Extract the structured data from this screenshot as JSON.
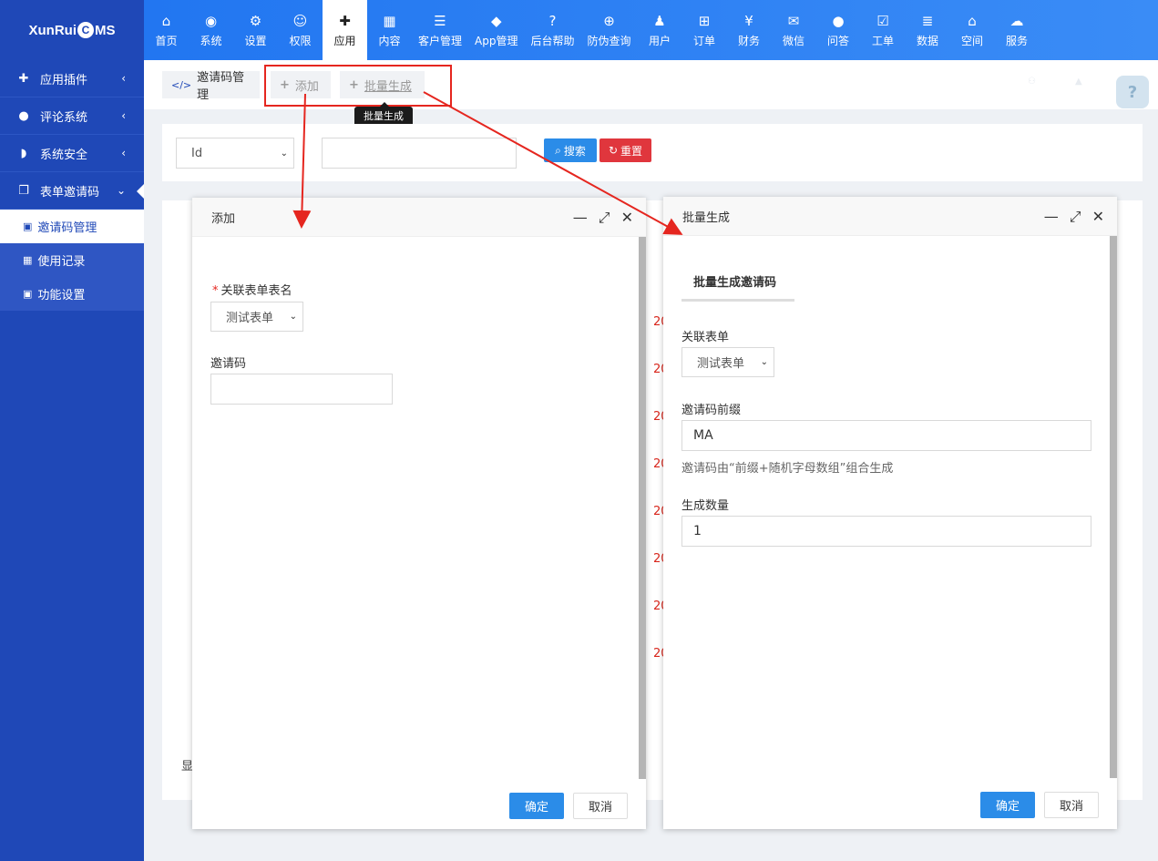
{
  "brand": {
    "logo_prefix": "XunRui",
    "logo_c": "C",
    "logo_suffix": "MS"
  },
  "nav": [
    {
      "label": "首页",
      "icon": "home-icon",
      "glyph": "⌂"
    },
    {
      "label": "系统",
      "icon": "globe-icon",
      "glyph": "◉"
    },
    {
      "label": "设置",
      "icon": "cogs-icon",
      "glyph": "⚙"
    },
    {
      "label": "权限",
      "icon": "user-circle-icon",
      "glyph": "☺"
    },
    {
      "label": "应用",
      "icon": "puzzle-icon",
      "glyph": "✚",
      "active": true
    },
    {
      "label": "内容",
      "icon": "th-large-icon",
      "glyph": "▦"
    },
    {
      "label": "客户管理",
      "icon": "server-icon",
      "glyph": "☰"
    },
    {
      "label": "App管理",
      "icon": "android-icon",
      "glyph": "◆"
    },
    {
      "label": "后台帮助",
      "icon": "question-icon",
      "glyph": "?"
    },
    {
      "label": "防伪查询",
      "icon": "search-plus-icon",
      "glyph": "⊕"
    },
    {
      "label": "用户",
      "icon": "user-icon",
      "glyph": "♟"
    },
    {
      "label": "订单",
      "icon": "cart-icon",
      "glyph": "⊞"
    },
    {
      "label": "财务",
      "icon": "yen-icon",
      "glyph": "¥"
    },
    {
      "label": "微信",
      "icon": "wechat-icon",
      "glyph": "✉"
    },
    {
      "label": "问答",
      "icon": "comment-icon",
      "glyph": "●"
    },
    {
      "label": "工单",
      "icon": "calendar-check-icon",
      "glyph": "☑"
    },
    {
      "label": "数据",
      "icon": "database-icon",
      "glyph": "≣"
    },
    {
      "label": "空间",
      "icon": "home-space-icon",
      "glyph": "⌂"
    },
    {
      "label": "服务",
      "icon": "cloud-icon",
      "glyph": "☁"
    }
  ],
  "sidebar": {
    "items": [
      {
        "label": "应用插件",
        "icon": "puzzle-icon",
        "glyph": "✚",
        "arrow": "‹"
      },
      {
        "label": "评论系统",
        "icon": "comments-icon",
        "glyph": "●",
        "arrow": "‹"
      },
      {
        "label": "系统安全",
        "icon": "shield-icon",
        "glyph": "◗",
        "arrow": "‹"
      },
      {
        "label": "表单邀请码",
        "icon": "copy-icon",
        "glyph": "❐",
        "arrow": "⌄"
      }
    ],
    "subitems": [
      {
        "label": "邀请码管理",
        "icon": "qrcode-icon",
        "glyph": "▣",
        "active": true
      },
      {
        "label": "使用记录",
        "icon": "calendar-icon",
        "glyph": "▦"
      },
      {
        "label": "功能设置",
        "icon": "qrcode-icon",
        "glyph": "▣"
      }
    ]
  },
  "tabs": {
    "manage": "邀请码管理",
    "manage_icon": "</>",
    "add": "添加",
    "batch": "批量生成",
    "plus": "+"
  },
  "tooltip": "批量生成",
  "search": {
    "field_select": "Id",
    "search_label": "搜索",
    "reset_label": "重置"
  },
  "list": {
    "show_text": "显",
    "row_prefix": "20"
  },
  "add_dialog": {
    "title": "添加",
    "form_label": "关联表单表名",
    "form_value": "测试表单",
    "code_label": "邀请码",
    "code_value": "",
    "ok": "确定",
    "cancel": "取消"
  },
  "batch_dialog": {
    "title": "批量生成",
    "section_title": "批量生成邀请码",
    "form_label": "关联表单",
    "form_value": "测试表单",
    "prefix_label": "邀请码前缀",
    "prefix_value": "MA",
    "help_text": "邀请码由“前缀+随机字母数组”组合生成",
    "count_label": "生成数量",
    "count_value": "1",
    "ok": "确定",
    "cancel": "取消"
  },
  "colors": {
    "topbar": "#1e73f0",
    "sidebar": "#1f48b7",
    "primary_button": "#2b8ce8",
    "danger_button": "#e0363d",
    "annotation": "#e5261f"
  }
}
